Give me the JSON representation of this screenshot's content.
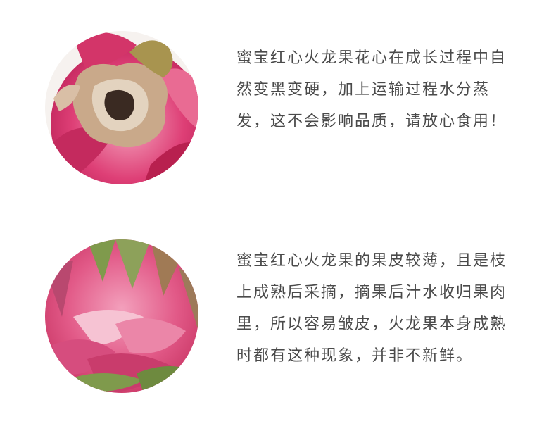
{
  "sections": [
    {
      "image": "dragon-fruit-top-photo",
      "text": "蜜宝红心火龙果花心在成长过程中自然变黑变硬，加上运输过程水分蒸发，这不会影响品质，请放心食用！"
    },
    {
      "image": "dragon-fruit-skin-photo",
      "text": "蜜宝红心火龙果的果皮较薄，且是枝上成熟后采摘，摘果后汁水收归果肉里，所以容易皱皮，火龙果本身成熟时都有这种现象，并非不新鲜。"
    }
  ],
  "colors": {
    "background": "#ffffff",
    "text": "#4a4a4a",
    "fruit_pink": "#d8356d",
    "fruit_light_pink": "#ee8fae",
    "dried_flower": "#c9a98a",
    "bract_green": "#7f9a4c"
  }
}
